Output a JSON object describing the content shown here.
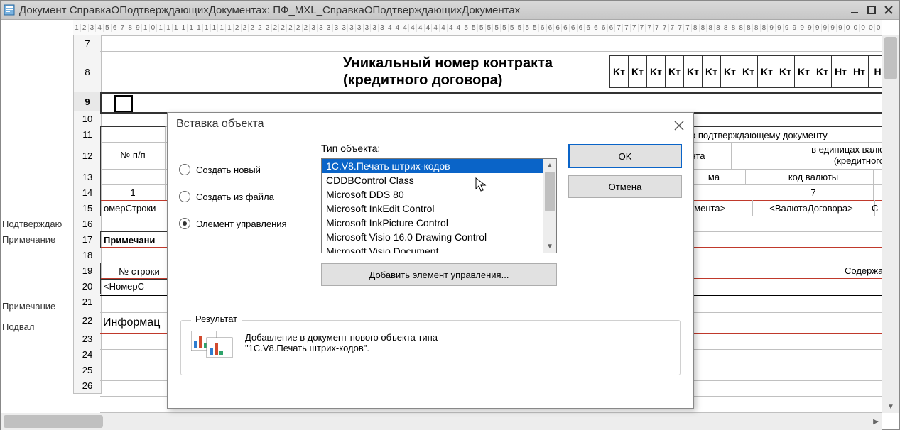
{
  "window": {
    "title": "Документ СправкаОПодтверждающихДокументах: ПФ_MXL_СправкаОПодтверждающихДокументах"
  },
  "ruler": "1234567891011111111112222222222333333333344444444445555555555666666666677777777778888888888999999999900000",
  "row_labels": {
    "r15": "Подтверждаю",
    "r16": "Примечание",
    "r20": "Примечание",
    "r21": "Подвал"
  },
  "rows": [
    7,
    8,
    9,
    10,
    11,
    12,
    13,
    14,
    15,
    16,
    17,
    18,
    19,
    20,
    21,
    22,
    23,
    24,
    25,
    26
  ],
  "selected_row": 9,
  "grid": {
    "heading": "Уникальный номер контракта (кредитного договора)",
    "kt": [
      "Kт",
      "Kт",
      "Kт",
      "Kт",
      "Kт",
      "Kт",
      "Kт",
      "Kт",
      "Kт",
      "Kт",
      "Kт",
      "Kт",
      "Hт",
      "Hт",
      "H"
    ],
    "col11a": "№ п/п",
    "col11_right1": "по подтверждающему документу",
    "col12_right1": "ента",
    "col12_right2": "в единицах валю",
    "col12_right3": "(кредитного",
    "col13_right1": "ма",
    "col13_right2": "код валюты",
    "cell14_1": "1",
    "cell14_7": "7",
    "cell15_1": "омерСтроки",
    "cell15_2": "кумента>",
    "cell15_3": "<ВалютаДоговора>",
    "cell15_4": "С",
    "cell17": "Примечани",
    "cell19": "№ строки",
    "cell19b": "Содержание",
    "cell20a": "<НомерС",
    "cell22": "Информац"
  },
  "dialog": {
    "title": "Вставка объекта",
    "radio1": "Создать новый",
    "radio2": "Создать из файла",
    "radio3": "Элемент управления",
    "radio_selected": 3,
    "list_label": "Тип объекта:",
    "list": [
      "1C.V8.Печать штрих-кодов",
      "CDDBControl Class",
      "Microsoft DDS 80",
      "Microsoft InkEdit Control",
      "Microsoft InkPicture Control",
      "Microsoft Visio 16.0 Drawing Control",
      "Microsoft Visio Document"
    ],
    "list_selected": 0,
    "add_button": "Добавить элемент управления...",
    "ok": "OK",
    "cancel": "Отмена",
    "result_label": "Результат",
    "result_text1": "Добавление в документ нового объекта типа",
    "result_text2": "\"1C.V8.Печать штрих-кодов\"."
  }
}
